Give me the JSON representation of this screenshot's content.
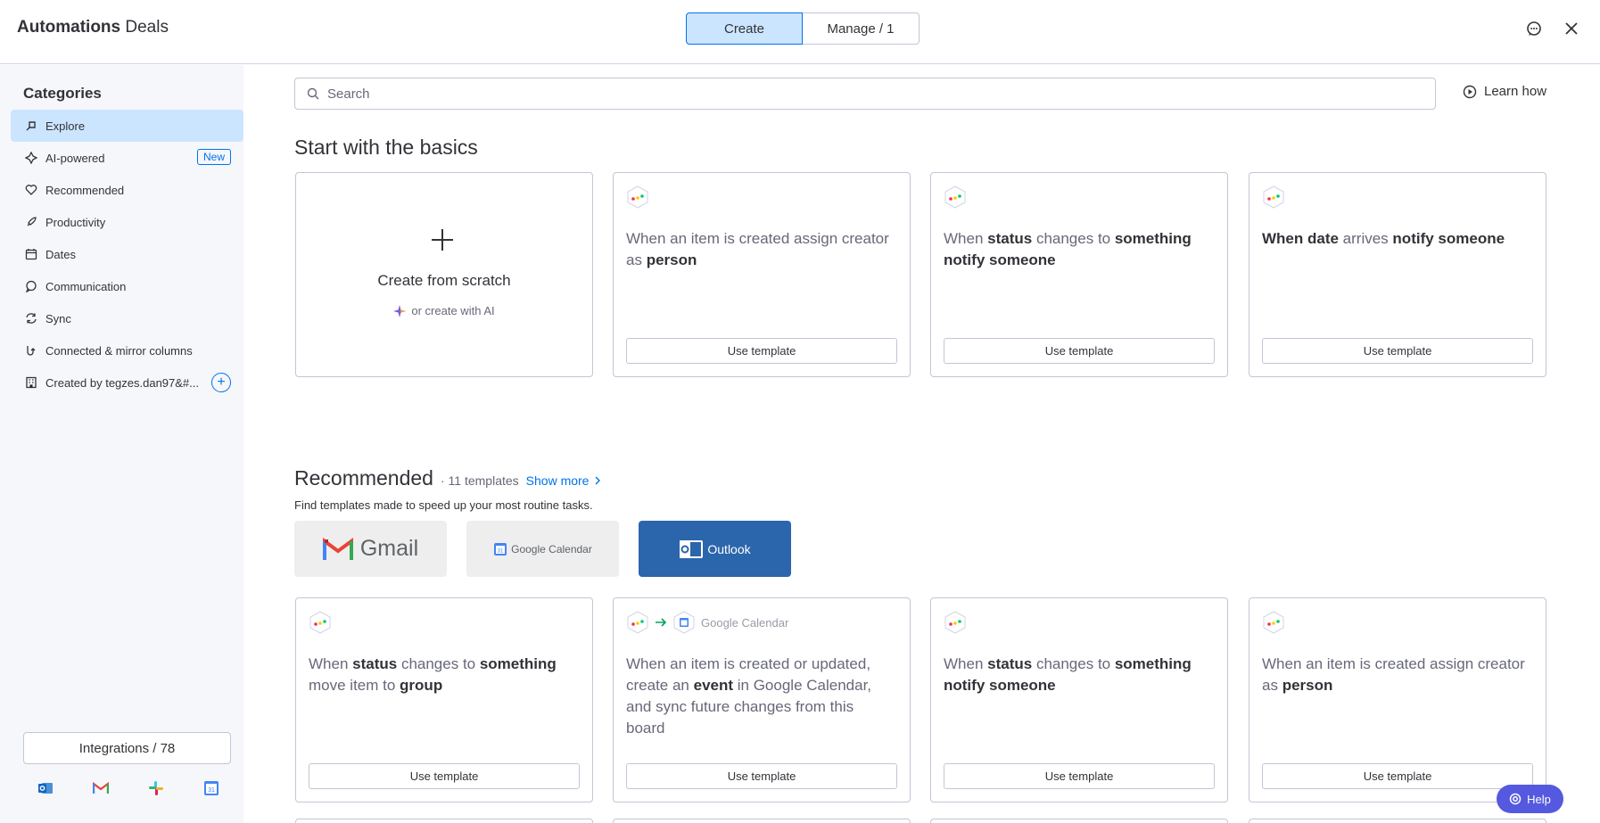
{
  "header": {
    "title_bold": "Automations",
    "title_light": "Deals",
    "tabs": [
      {
        "label": "Create",
        "active": true
      },
      {
        "label": "Manage / 1",
        "active": false
      }
    ],
    "icons": [
      "feedback-icon",
      "close-icon"
    ]
  },
  "sidebar": {
    "title": "Categories",
    "items": [
      {
        "label": "Explore",
        "icon": "explore-icon",
        "active": true
      },
      {
        "label": "AI-powered",
        "icon": "ai-icon",
        "badge": "New"
      },
      {
        "label": "Recommended",
        "icon": "heart-icon"
      },
      {
        "label": "Productivity",
        "icon": "rocket-icon"
      },
      {
        "label": "Dates",
        "icon": "calendar-icon"
      },
      {
        "label": "Communication",
        "icon": "chat-icon"
      },
      {
        "label": "Sync",
        "icon": "sync-icon"
      },
      {
        "label": "Connected & mirror columns",
        "icon": "connect-icon"
      },
      {
        "label": "Created by tegzes.dan97&#...",
        "icon": "building-icon"
      }
    ],
    "integrations_label": "Integrations / 78",
    "integration_icons": [
      "outlook-icon",
      "gmail-icon",
      "slack-icon",
      "google-calendar-icon"
    ]
  },
  "search": {
    "placeholder": "Search"
  },
  "learn_how": "Learn how",
  "basics": {
    "title": "Start with the basics",
    "scratch": {
      "label": "Create from scratch",
      "ai_label": "or create with AI"
    },
    "use_template": "Use template",
    "cards": [
      {
        "parts": [
          [
            "When an item is created assign creator as ",
            false
          ],
          [
            "person",
            true
          ]
        ]
      },
      {
        "parts": [
          [
            "When ",
            false
          ],
          [
            "status",
            true
          ],
          [
            " changes to ",
            false
          ],
          [
            "something notify someone",
            true
          ]
        ]
      },
      {
        "parts": [
          [
            "When date",
            true
          ],
          [
            " arrives ",
            false
          ],
          [
            "notify someone",
            true
          ]
        ]
      }
    ]
  },
  "recommended": {
    "title": "Recommended",
    "count": "11 templates",
    "show_more": "Show more",
    "subtitle": "Find templates made to speed up your most routine tasks.",
    "brands": [
      {
        "label": "Gmail"
      },
      {
        "label": "Google Calendar"
      },
      {
        "label": "Outlook"
      }
    ],
    "card2_integration": "Google Calendar",
    "cards": [
      {
        "parts": [
          [
            "When ",
            false
          ],
          [
            "status",
            true
          ],
          [
            " changes to ",
            false
          ],
          [
            "something",
            true
          ],
          [
            " move item to ",
            false
          ],
          [
            "group",
            true
          ]
        ]
      },
      {
        "parts": [
          [
            "When an item is created or updated, create an ",
            false
          ],
          [
            "event",
            true
          ],
          [
            " in Google Calendar, and sync future changes from this board",
            false
          ]
        ]
      },
      {
        "parts": [
          [
            "When ",
            false
          ],
          [
            "status",
            true
          ],
          [
            " changes to ",
            false
          ],
          [
            "something notify someone",
            true
          ]
        ]
      },
      {
        "parts": [
          [
            "When an item is created assign creator as ",
            false
          ],
          [
            "person",
            true
          ]
        ]
      }
    ]
  },
  "help_label": "Help",
  "colors": {
    "accent": "#0073ea",
    "active_bg": "#cce5ff",
    "help": "#5559df",
    "outlook": "#2b65ac"
  }
}
